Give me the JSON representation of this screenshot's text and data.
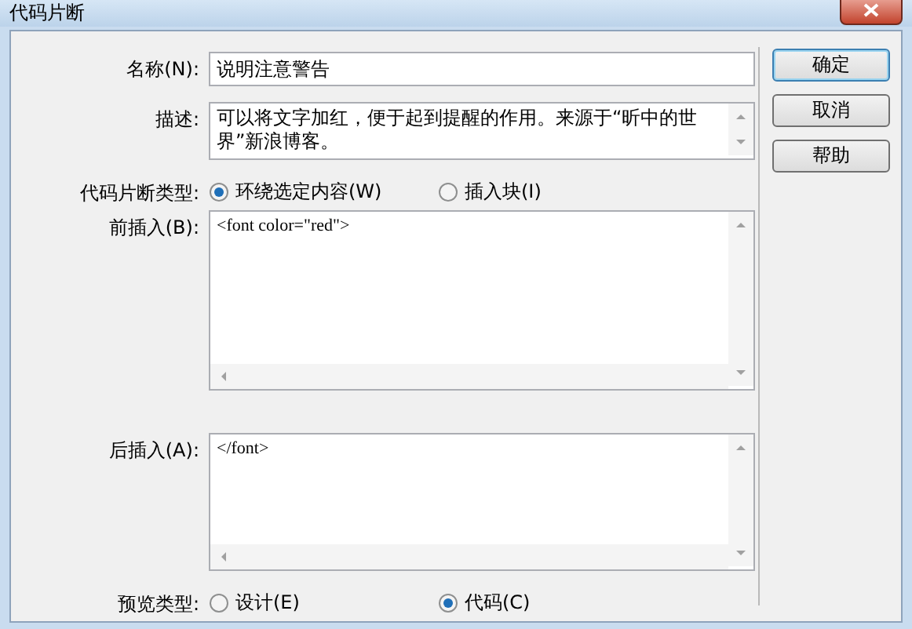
{
  "window": {
    "title": "代码片断"
  },
  "name": {
    "label": "名称(N):",
    "value": "说明注意警告"
  },
  "description": {
    "label": "描述:",
    "value": "可以将文字加红，便于起到提醒的作用。来源于“昕中的世界”新浪博客。"
  },
  "snippet_type": {
    "label": "代码片断类型:",
    "options": [
      {
        "label": "环绕选定内容(W)",
        "selected": true
      },
      {
        "label": "插入块(I)",
        "selected": false
      }
    ]
  },
  "before_insert": {
    "label": "前插入(B):",
    "value": "<font color=\"red\">"
  },
  "after_insert": {
    "label": "后插入(A):",
    "value": "</font>"
  },
  "preview_type": {
    "label": "预览类型:",
    "options": [
      {
        "label": "设计(E)",
        "selected": false
      },
      {
        "label": "代码(C)",
        "selected": true
      }
    ]
  },
  "buttons": [
    {
      "label": "确定",
      "default": true
    },
    {
      "label": "取消",
      "default": false
    },
    {
      "label": "帮助",
      "default": false
    }
  ]
}
